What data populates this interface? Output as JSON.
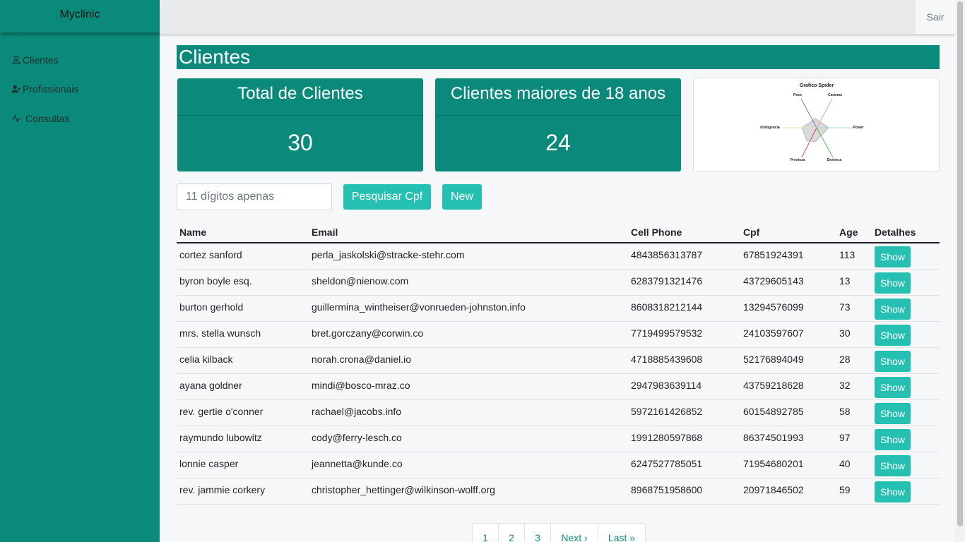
{
  "app": {
    "brand": "Myclinic",
    "logout": "Sair"
  },
  "sidebar": {
    "items": [
      {
        "label": "Clientes",
        "icon": "person-icon"
      },
      {
        "label": "Profissionais",
        "icon": "person-plus-icon"
      },
      {
        "label": "Consultas",
        "icon": "activity-icon"
      }
    ]
  },
  "page": {
    "title": "Clientes"
  },
  "stats": [
    {
      "label": "Total de Clientes",
      "value": "30"
    },
    {
      "label": "Clientes maiores de 18 anos",
      "value": "24"
    }
  ],
  "chart_data": {
    "type": "radar",
    "title": "Grafico Spider",
    "axes": [
      "Peso",
      "Carisma",
      "Power",
      "Destreza",
      "Presteza",
      "Inteligencia"
    ]
  },
  "search": {
    "placeholder": "11 dígitos apenas",
    "button": "Pesquisar Cpf",
    "new_button": "New"
  },
  "table": {
    "headers": [
      "Name",
      "Email",
      "Cell Phone",
      "Cpf",
      "Age",
      "Detalhes"
    ],
    "action_label": "Show",
    "rows": [
      [
        "cortez sanford",
        "perla_jaskolski@stracke-stehr.com",
        "4843856313787",
        "67851924391",
        "113"
      ],
      [
        "byron boyle esq.",
        "sheldon@nienow.com",
        "6283791321476",
        "43729605143",
        "13"
      ],
      [
        "burton gerhold",
        "guillermina_wintheiser@vonrueden-johnston.info",
        "8608318212144",
        "13294576099",
        "73"
      ],
      [
        "mrs. stella wunsch",
        "bret.gorczany@corwin.co",
        "7719499579532",
        "24103597607",
        "30"
      ],
      [
        "celia kilback",
        "norah.crona@daniel.io",
        "4718885439608",
        "52176894049",
        "28"
      ],
      [
        "ayana goldner",
        "mindi@bosco-mraz.co",
        "2947983639114",
        "43759218628",
        "32"
      ],
      [
        "rev. gertie o'conner",
        "rachael@jacobs.info",
        "5972161426852",
        "60154892785",
        "58"
      ],
      [
        "raymundo lubowitz",
        "cody@ferry-lesch.co",
        "1991280597868",
        "86374501993",
        "97"
      ],
      [
        "lonnie casper",
        "jeannetta@kunde.co",
        "6247527785051",
        "71954680201",
        "40"
      ],
      [
        "rev. jammie corkery",
        "christopher_hettinger@wilkinson-wolff.org",
        "8968751958600",
        "20971846502",
        "59"
      ]
    ]
  },
  "pagination": [
    "1",
    "2",
    "3",
    "Next ›",
    "Last »"
  ]
}
